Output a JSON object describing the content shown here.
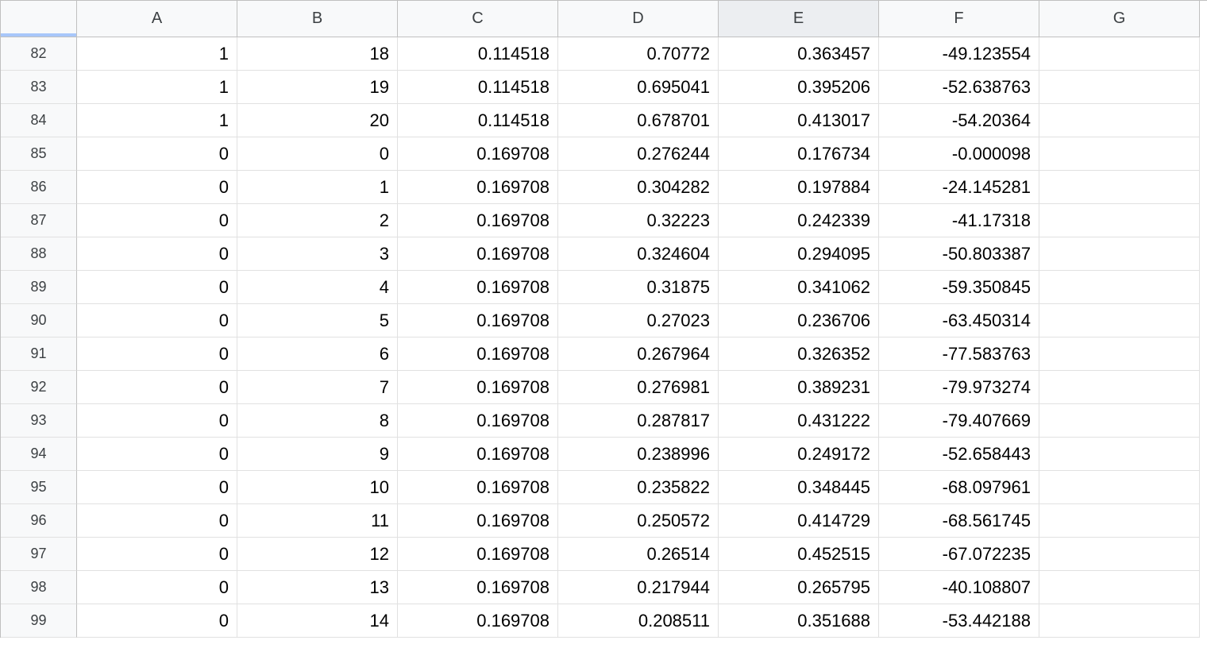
{
  "columns": [
    "A",
    "B",
    "C",
    "D",
    "E",
    "F",
    "G"
  ],
  "selected_column_index": 4,
  "row_start": 82,
  "rows": [
    {
      "n": 82,
      "A": "1",
      "B": "18",
      "C": "0.114518",
      "D": "0.70772",
      "E": "0.363457",
      "F": "-49.123554",
      "G": ""
    },
    {
      "n": 83,
      "A": "1",
      "B": "19",
      "C": "0.114518",
      "D": "0.695041",
      "E": "0.395206",
      "F": "-52.638763",
      "G": ""
    },
    {
      "n": 84,
      "A": "1",
      "B": "20",
      "C": "0.114518",
      "D": "0.678701",
      "E": "0.413017",
      "F": "-54.20364",
      "G": ""
    },
    {
      "n": 85,
      "A": "0",
      "B": "0",
      "C": "0.169708",
      "D": "0.276244",
      "E": "0.176734",
      "F": "-0.000098",
      "G": ""
    },
    {
      "n": 86,
      "A": "0",
      "B": "1",
      "C": "0.169708",
      "D": "0.304282",
      "E": "0.197884",
      "F": "-24.145281",
      "G": ""
    },
    {
      "n": 87,
      "A": "0",
      "B": "2",
      "C": "0.169708",
      "D": "0.32223",
      "E": "0.242339",
      "F": "-41.17318",
      "G": ""
    },
    {
      "n": 88,
      "A": "0",
      "B": "3",
      "C": "0.169708",
      "D": "0.324604",
      "E": "0.294095",
      "F": "-50.803387",
      "G": ""
    },
    {
      "n": 89,
      "A": "0",
      "B": "4",
      "C": "0.169708",
      "D": "0.31875",
      "E": "0.341062",
      "F": "-59.350845",
      "G": ""
    },
    {
      "n": 90,
      "A": "0",
      "B": "5",
      "C": "0.169708",
      "D": "0.27023",
      "E": "0.236706",
      "F": "-63.450314",
      "G": ""
    },
    {
      "n": 91,
      "A": "0",
      "B": "6",
      "C": "0.169708",
      "D": "0.267964",
      "E": "0.326352",
      "F": "-77.583763",
      "G": ""
    },
    {
      "n": 92,
      "A": "0",
      "B": "7",
      "C": "0.169708",
      "D": "0.276981",
      "E": "0.389231",
      "F": "-79.973274",
      "G": ""
    },
    {
      "n": 93,
      "A": "0",
      "B": "8",
      "C": "0.169708",
      "D": "0.287817",
      "E": "0.431222",
      "F": "-79.407669",
      "G": ""
    },
    {
      "n": 94,
      "A": "0",
      "B": "9",
      "C": "0.169708",
      "D": "0.238996",
      "E": "0.249172",
      "F": "-52.658443",
      "G": ""
    },
    {
      "n": 95,
      "A": "0",
      "B": "10",
      "C": "0.169708",
      "D": "0.235822",
      "E": "0.348445",
      "F": "-68.097961",
      "G": ""
    },
    {
      "n": 96,
      "A": "0",
      "B": "11",
      "C": "0.169708",
      "D": "0.250572",
      "E": "0.414729",
      "F": "-68.561745",
      "G": ""
    },
    {
      "n": 97,
      "A": "0",
      "B": "12",
      "C": "0.169708",
      "D": "0.26514",
      "E": "0.452515",
      "F": "-67.072235",
      "G": ""
    },
    {
      "n": 98,
      "A": "0",
      "B": "13",
      "C": "0.169708",
      "D": "0.217944",
      "E": "0.265795",
      "F": "-40.108807",
      "G": ""
    },
    {
      "n": 99,
      "A": "0",
      "B": "14",
      "C": "0.169708",
      "D": "0.208511",
      "E": "0.351688",
      "F": "-53.442188",
      "G": ""
    }
  ]
}
